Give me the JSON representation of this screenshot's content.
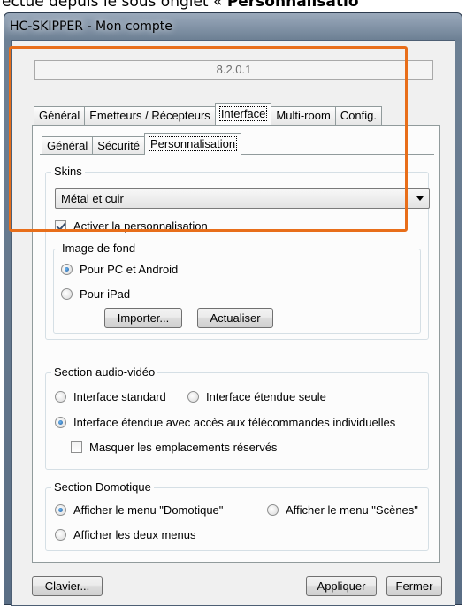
{
  "caption": {
    "text_prefix": "ectue depuis le sous onglet « ",
    "text_bold": "Personnalisatio"
  },
  "window": {
    "title": "HC-SKIPPER - Mon compte",
    "version": "8.2.0.1"
  },
  "main_tabs": [
    "Général",
    "Emetteurs / Récepteurs",
    "Interface",
    "Multi-room",
    "Config."
  ],
  "main_tab_active": "Interface",
  "sub_tabs": [
    "Général",
    "Sécurité",
    "Personnalisation"
  ],
  "sub_tab_active": "Personnalisation",
  "skins": {
    "title": "Skins",
    "selected": "Métal et cuir",
    "activate_label": "Activer la personnalisation",
    "activate_checked": true,
    "background": {
      "title": "Image de fond",
      "option_pc": "Pour PC et Android",
      "option_ipad": "Pour iPad",
      "selected": "Pour PC et Android",
      "import_label": "Importer...",
      "refresh_label": "Actualiser"
    }
  },
  "audio_video": {
    "title": "Section audio-vidéo",
    "option_standard": "Interface standard",
    "option_extended_only": "Interface étendue seule",
    "option_extended_remotes": "Interface étendue avec accès aux télécommandes individuelles",
    "selected": "Interface étendue avec accès aux télécommandes individuelles",
    "hide_reserved_label": "Masquer les emplacements réservés",
    "hide_reserved_checked": false
  },
  "domotique": {
    "title": "Section Domotique",
    "option_domotique": "Afficher le menu \"Domotique\"",
    "option_scenes": "Afficher le menu \"Scènes\"",
    "option_both": "Afficher les deux menus",
    "selected": "Afficher le menu \"Domotique\""
  },
  "buttons": {
    "keyboard": "Clavier...",
    "apply": "Appliquer",
    "close": "Fermer"
  },
  "colors": {
    "highlight": "#e86e1a",
    "radio_selected": "#1f5c9c"
  }
}
